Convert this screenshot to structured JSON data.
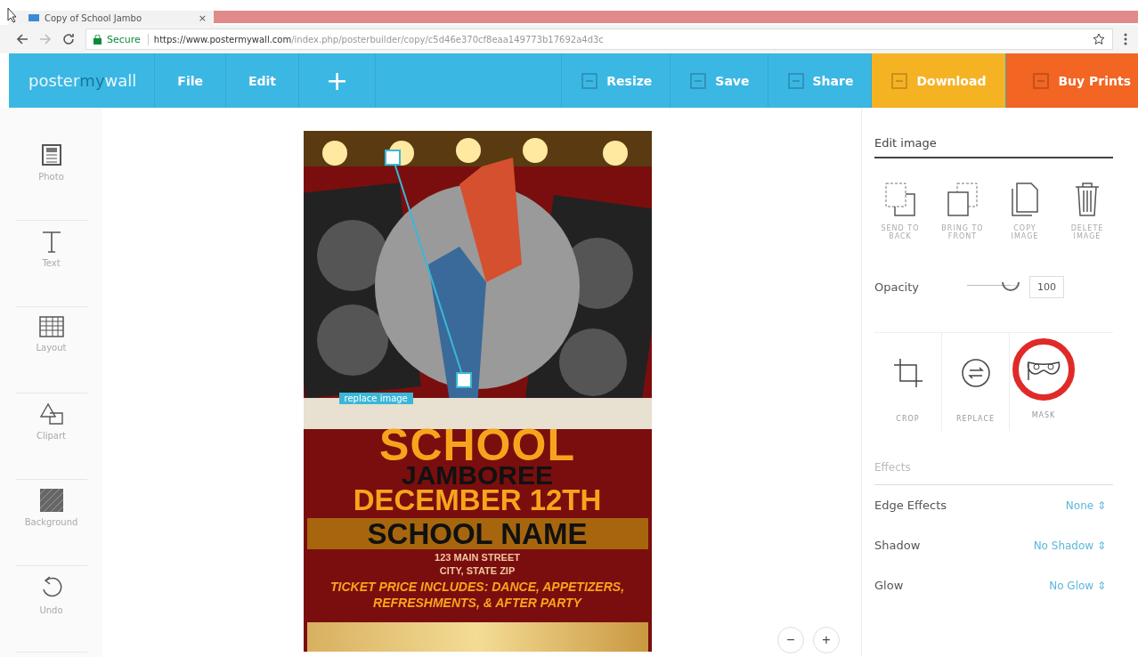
{
  "browser": {
    "tab": {
      "title": "Copy of School Jambo",
      "close": "×"
    },
    "secure": "Secure",
    "url_host": "https://www.postermywall.com",
    "url_path": "/index.php/posterbuilder/copy/c5d46e370cf8eaa149773b17692a4d3c"
  },
  "toolbar": {
    "logo": [
      "poster",
      "my",
      "wall"
    ],
    "menus": [
      {
        "label": "File"
      },
      {
        "label": "Edit"
      },
      {
        "label": "+"
      }
    ],
    "actions": [
      {
        "label": "Resize",
        "color": "#3bb7e4"
      },
      {
        "label": "Save",
        "color": "#3bb7e4"
      },
      {
        "label": "Share",
        "color": "#3bb7e4"
      },
      {
        "label": "Download",
        "color": "#f5b324"
      },
      {
        "label": "Buy Prints",
        "color": "#f26522"
      }
    ]
  },
  "sidebar": {
    "items": [
      {
        "label": "Photo"
      },
      {
        "label": "Text"
      },
      {
        "label": "Layout"
      },
      {
        "label": "Clipart"
      },
      {
        "label": "Background"
      },
      {
        "label": "Undo"
      }
    ]
  },
  "poster": {
    "selection_tag": "replace image",
    "title": "SCHOOL",
    "subtitle": "JAMBOREE",
    "date": "DECEMBER 12TH",
    "school": "SCHOOL NAME",
    "address": [
      "123 MAIN STREET",
      "CITY, STATE ZIP"
    ],
    "details": "TICKET PRICE INCLUDES: DANCE, APPETIZERS, REFRESHMENTS, & AFTER PARTY"
  },
  "zoom": [
    "−",
    "+"
  ],
  "panel": {
    "heading": "Edit image",
    "actions": [
      {
        "label": "SEND TO BACK"
      },
      {
        "label": "BRING TO FRONT"
      },
      {
        "label": "COPY IMAGE"
      },
      {
        "label": "DELETE IMAGE"
      }
    ],
    "opacity": {
      "label": "Opacity",
      "level": 0.88,
      "value": "100"
    },
    "tools": [
      {
        "label": "CROP",
        "highlighted": false
      },
      {
        "label": "REPLACE",
        "highlighted": false
      },
      {
        "label": "MASK",
        "highlighted": true
      }
    ],
    "effects_heading": "Effects",
    "effects": [
      {
        "label": "Edge Effects",
        "value": "None ⇕"
      },
      {
        "label": "Shadow",
        "value": "No Shadow ⇕"
      },
      {
        "label": "Glow",
        "value": "No Glow ⇕"
      }
    ]
  }
}
